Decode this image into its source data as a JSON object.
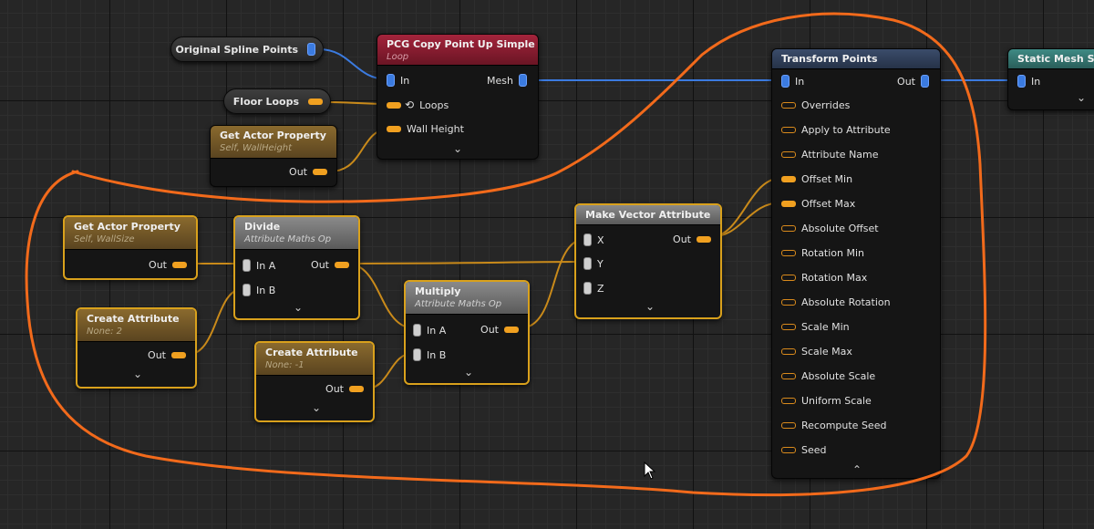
{
  "colors": {
    "accent_orange": "#f26a1b",
    "pin_blue": "#3b7be0",
    "pin_orange": "#f0a020",
    "header_red": "#a4243c",
    "selection_gold": "#d9a11c"
  },
  "nodes": {
    "original_spline": {
      "title": "Original Spline Points"
    },
    "floor_loops": {
      "title": "Floor Loops"
    },
    "copy_point": {
      "title": "PCG Copy Point Up Simple",
      "subtitle": "Loop",
      "in": "In",
      "mesh": "Mesh",
      "loops": "Loops",
      "wall_height": "Wall Height"
    },
    "get_wallheight": {
      "title": "Get Actor Property",
      "subtitle": "Self, WallHeight",
      "out": "Out"
    },
    "get_wallsize": {
      "title": "Get Actor Property",
      "subtitle": "Self, WallSize",
      "out": "Out"
    },
    "create_attr_2": {
      "title": "Create Attribute",
      "subtitle": "None: 2",
      "out": "Out"
    },
    "divide": {
      "title": "Divide",
      "subtitle": "Attribute Maths Op",
      "in_a": "In A",
      "in_b": "In B",
      "out": "Out"
    },
    "create_attr_neg1": {
      "title": "Create Attribute",
      "subtitle": "None: -1",
      "out": "Out"
    },
    "multiply": {
      "title": "Multiply",
      "subtitle": "Attribute Maths Op",
      "in_a": "In A",
      "in_b": "In B",
      "out": "Out"
    },
    "make_vector": {
      "title": "Make Vector Attribute",
      "x": "X",
      "y": "Y",
      "z": "Z",
      "out": "Out"
    },
    "transform_points": {
      "title": "Transform Points",
      "in": "In",
      "out": "Out",
      "pins": [
        "Overrides",
        "Apply to Attribute",
        "Attribute Name",
        "Offset Min",
        "Offset Max",
        "Absolute Offset",
        "Rotation Min",
        "Rotation Max",
        "Absolute Rotation",
        "Scale Min",
        "Scale Max",
        "Absolute Scale",
        "Uniform Scale",
        "Recompute Seed",
        "Seed"
      ]
    },
    "static_mesh": {
      "title": "Static Mesh Spa",
      "in": "In"
    }
  }
}
